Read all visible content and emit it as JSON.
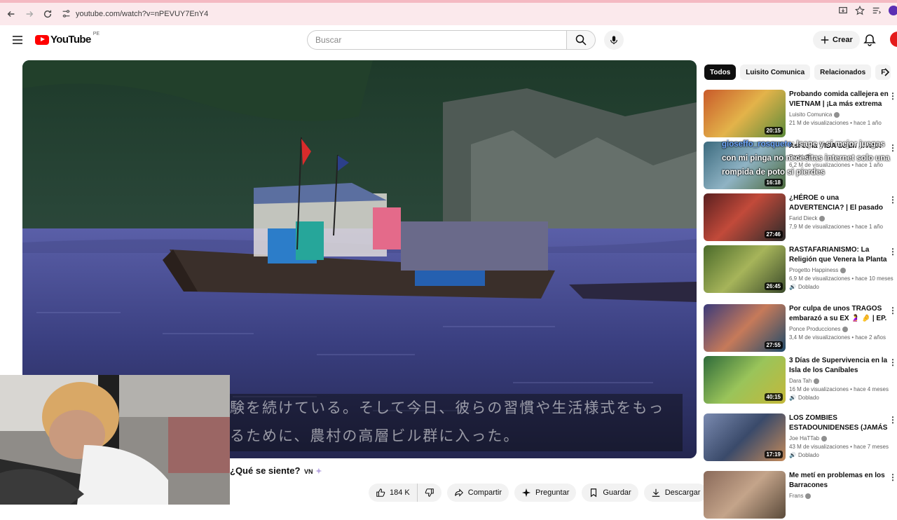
{
  "browser": {
    "url": "youtube.com/watch?v=nPEVUY7EnY4"
  },
  "header": {
    "logo_text": "YouTube",
    "country_code": "PE",
    "search_placeholder": "Buscar",
    "create_label": "Crear"
  },
  "video": {
    "subtitle_line1": "験を続けている。そして今日、彼らの習慣や生活様式をもっ",
    "subtitle_line2": "るために、農村の高層ビル群に入った。",
    "title": "¿Qué se siente?",
    "title_country": "VN",
    "likes": "184 K",
    "share_label": "Compartir",
    "ask_label": "Preguntar",
    "save_label": "Guardar",
    "download_label": "Descargar"
  },
  "chips": [
    "Todos",
    "Luisito Comunica",
    "Relacionados",
    "F"
  ],
  "recommendations": [
    {
      "title": "Probando comida callejera en VIETNAM | ¡La más extrema d...",
      "channel": "Luisito Comunica",
      "meta": "21 M de visualizaciones • hace 1 año",
      "duration": "20:15",
      "badge": ""
    },
    {
      "title": "Así es la VIDA de un ... ANA",
      "channel": "Rayki",
      "meta": "6,2 M de visualizaciones • hace 1 año",
      "duration": "16:18",
      "badge": ""
    },
    {
      "title": "¿HÉROE o una ADVERTENCIA? | El pasado de Scarface | Relato...",
      "channel": "Farid Dieck",
      "meta": "7,9 M de visualizaciones • hace 1 año",
      "duration": "27:46",
      "badge": ""
    },
    {
      "title": "RASTAFARIANISMO: La Religión que Venera la Planta ...",
      "channel": "Progetto Happiness",
      "meta": "6,9 M de visualizaciones • hace 10 meses",
      "duration": "26:45",
      "badge": "Doblado"
    },
    {
      "title": "Por culpa de unos TRAGOS embarazó a su EX 🤰 🤌 | EP. ...",
      "channel": "Ponce Producciones",
      "meta": "3,4 M de visualizaciones • hace 2 años",
      "duration": "27:55",
      "badge": ""
    },
    {
      "title": "3 Días de Supervivencia en la Isla de los Caníbales",
      "channel": "Dara Tah",
      "meta": "16 M de visualizaciones • hace 4 meses",
      "duration": "40:15",
      "badge": "Doblado"
    },
    {
      "title": "LOS ZOMBIES ESTADOUNIDENSES (JAMÁS ...",
      "channel": "Joe HaTTab",
      "meta": "43 M de visualizaciones • hace 7 meses",
      "duration": "17:19",
      "badge": "Doblado"
    },
    {
      "title": "Me metí en problemas en los Barracones",
      "channel": "Frans",
      "meta": "",
      "duration": "",
      "badge": ""
    }
  ],
  "chat": {
    "user": "gioseffo_rosquete",
    "message": ": Isape y si mejor juegas con mi pinga no necesitas internet solo una rompida de poto si pierdes"
  },
  "colors": {
    "brand_red": "#ff0000",
    "chrome_pink": "#fbe9ec"
  }
}
